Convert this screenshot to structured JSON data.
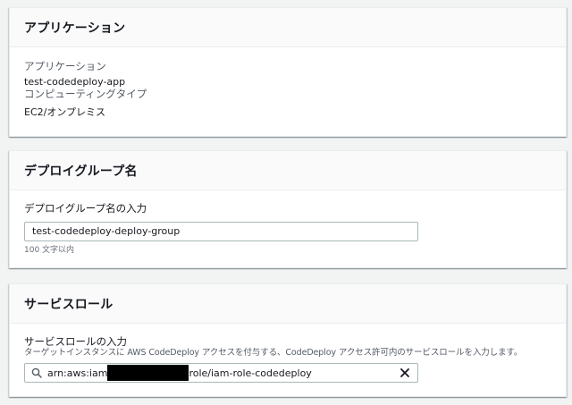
{
  "application": {
    "header": "アプリケーション",
    "app_label": "アプリケーション",
    "app_value": "test-codedeploy-app",
    "platform_label": "コンピューティングタイプ",
    "platform_value": "EC2/オンプレミス"
  },
  "deployment_group": {
    "header": "デプロイグループ名",
    "input_label": "デプロイグループ名の入力",
    "input_value": "test-codedeploy-deploy-group",
    "hint": "100 文字以内"
  },
  "service_role": {
    "header": "サービスロール",
    "input_label": "サービスロールの入力",
    "description": "ターゲットインスタンスに AWS CodeDeploy アクセスを付与する、CodeDeploy アクセス許可内のサービスロールを入力します。",
    "value_prefix": "arn:aws:iam",
    "value_suffix": "role/iam-role-codedeploy",
    "search_icon": "search-icon",
    "clear_icon": "close-icon"
  },
  "colors": {
    "page_background": "#f2f3f3",
    "panel_header": "#fafafa",
    "border": "#aab7b8",
    "text": "#16191f",
    "muted_text": "#545b64"
  }
}
